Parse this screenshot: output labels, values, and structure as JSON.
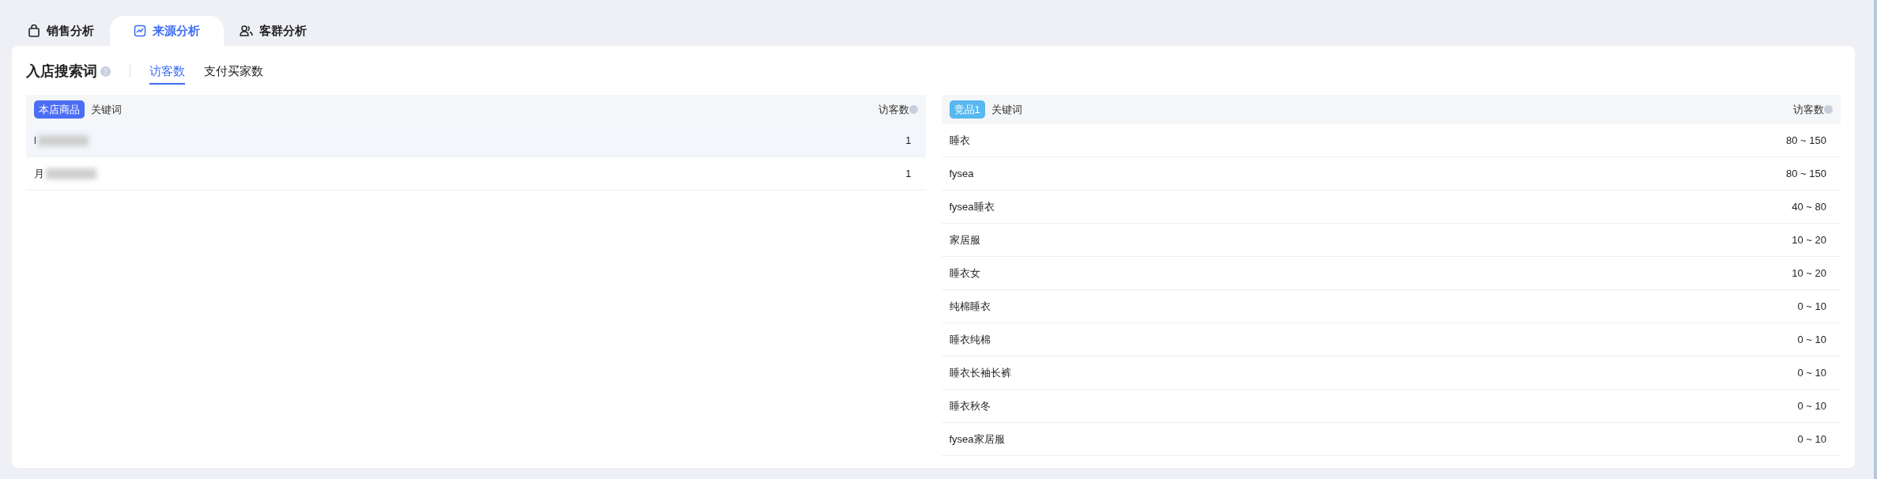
{
  "tabs": [
    {
      "label": "销售分析",
      "selected": false
    },
    {
      "label": "来源分析",
      "selected": true
    },
    {
      "label": "客群分析",
      "selected": false
    }
  ],
  "section": {
    "title": "入店搜索词",
    "subtabs": [
      {
        "label": "访客数",
        "selected": true
      },
      {
        "label": "支付买家数",
        "selected": false
      }
    ]
  },
  "own_table": {
    "badge": "本店商品",
    "keyword_header": "关键词",
    "value_header": "访客数",
    "rows": [
      {
        "keyword": "l",
        "blurred": true,
        "value": "1",
        "selected": true
      },
      {
        "keyword": "月",
        "blurred": true,
        "value": "1",
        "selected": false
      }
    ]
  },
  "rival_table": {
    "badge": "竞品1",
    "keyword_header": "关键词",
    "value_header": "访客数",
    "rows": [
      {
        "keyword": "睡衣",
        "value": "80 ~ 150"
      },
      {
        "keyword": "fysea",
        "value": "80 ~ 150"
      },
      {
        "keyword": "fysea睡衣",
        "value": "40 ~ 80"
      },
      {
        "keyword": "家居服",
        "value": "10 ~ 20"
      },
      {
        "keyword": "睡衣女",
        "value": "10 ~ 20"
      },
      {
        "keyword": "纯棉睡衣",
        "value": "0 ~ 10"
      },
      {
        "keyword": "睡衣纯棉",
        "value": "0 ~ 10"
      },
      {
        "keyword": "睡衣长袖长裤",
        "value": "0 ~ 10"
      },
      {
        "keyword": "睡衣秋冬",
        "value": "0 ~ 10"
      },
      {
        "keyword": "fysea家居服",
        "value": "0 ~ 10"
      }
    ]
  }
}
